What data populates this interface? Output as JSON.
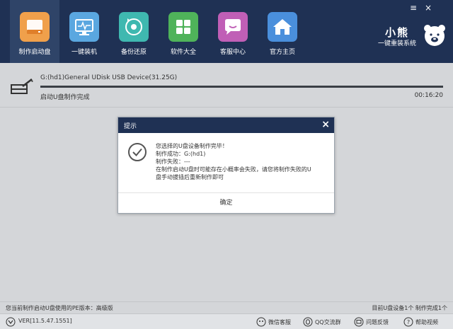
{
  "nav": {
    "items": [
      {
        "label": "制作启动盘",
        "icon": "usb-disk-icon",
        "color": "#f0a04b",
        "active": true
      },
      {
        "label": "一键装机",
        "icon": "monitor-icon",
        "color": "#5aa7e0"
      },
      {
        "label": "备份还原",
        "icon": "restore-icon",
        "color": "#3fb8b0"
      },
      {
        "label": "软件大全",
        "icon": "apps-grid-icon",
        "color": "#4fb35a"
      },
      {
        "label": "客服中心",
        "icon": "chat-icon",
        "color": "#c05fb6"
      },
      {
        "label": "官方主页",
        "icon": "home-icon",
        "color": "#4a8fdc"
      }
    ]
  },
  "window": {
    "menu": "≡",
    "close": "×"
  },
  "brand": {
    "title": "小熊",
    "subtitle": "一键重装系统"
  },
  "progress": {
    "device": "G:(hd1)General UDisk USB Device(31.25G)",
    "status": "启动U盘制作完成",
    "time": "00:16:20",
    "percent": 100
  },
  "dialog": {
    "title": "提示",
    "close": "×",
    "lines": [
      "您选择的U盘设备制作完毕！",
      "制作成功：G:(hd1)",
      "制作失败：---",
      "在制作启动U盘时可能存在小概率会失败，请您将制作失败的U",
      "盘手动拔插后重新制作即可"
    ],
    "ok": "确定"
  },
  "info": {
    "left": "您当前制作启动U盘使用的PE版本：高级版",
    "right": "目前U盘设备1个  制作完成1个"
  },
  "status": {
    "version": "VER[11.5.47.1551]",
    "links": [
      {
        "label": "微信客服",
        "icon": "wechat-icon"
      },
      {
        "label": "QQ交流群",
        "icon": "qq-icon"
      },
      {
        "label": "问题反馈",
        "icon": "feedback-icon"
      },
      {
        "label": "帮助视频",
        "icon": "help-icon"
      }
    ]
  }
}
